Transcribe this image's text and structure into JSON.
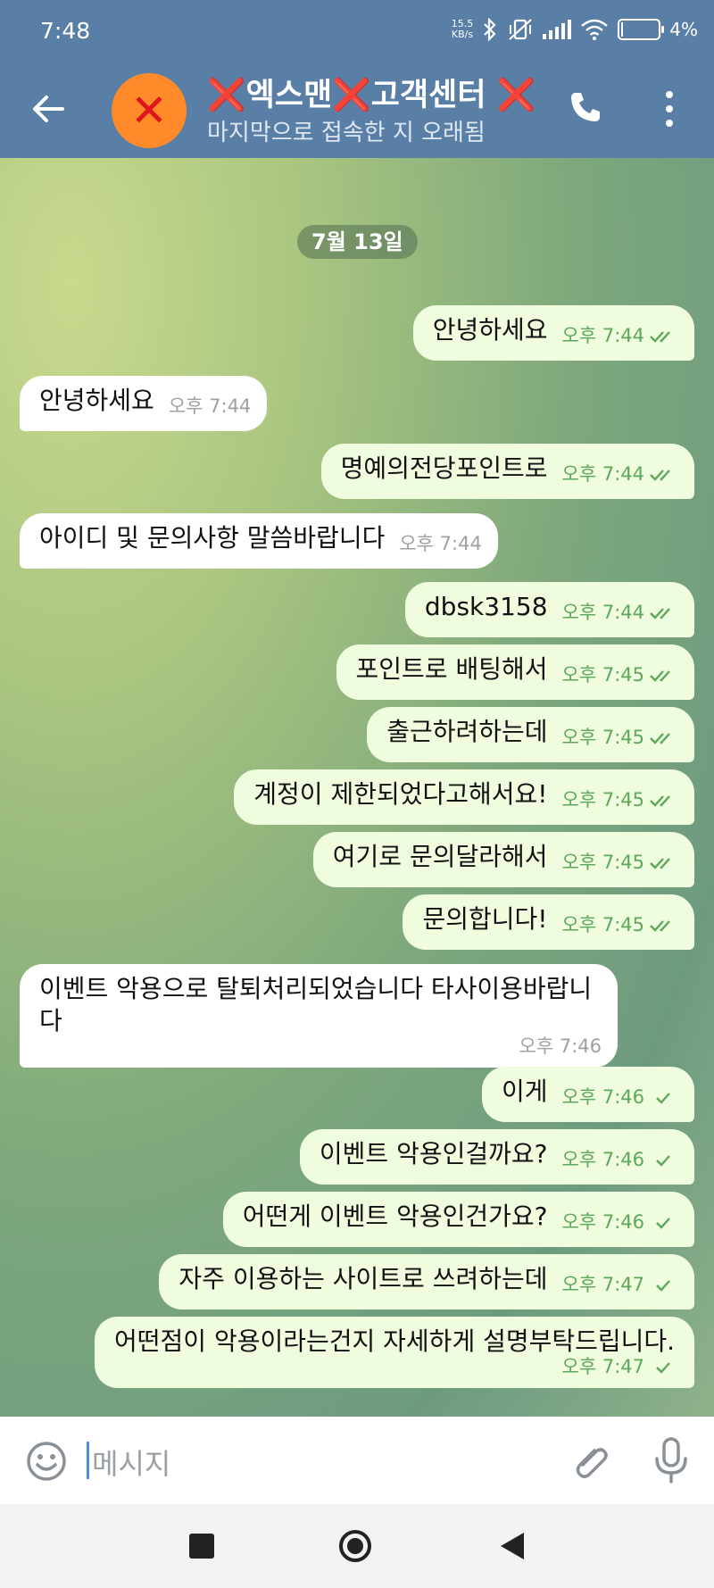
{
  "status_bar": {
    "time": "7:48",
    "net_speed_value": "15.5",
    "net_speed_unit": "KB/s",
    "battery": "4%"
  },
  "header": {
    "title": "❌엑스맨❌고객센터 ❌",
    "subtitle": "마지막으로 접속한 지 오래됨",
    "avatar_icon": "close-x-icon"
  },
  "chat": {
    "date": "7월 13일",
    "messages": [
      {
        "dir": "out",
        "text": "안녕하세요",
        "time": "오후 7:44",
        "status": "read"
      },
      {
        "dir": "in",
        "text": "안녕하세요",
        "time": "오후 7:44"
      },
      {
        "dir": "out",
        "text": "명예의전당포인트로",
        "time": "오후 7:44",
        "status": "read"
      },
      {
        "dir": "in",
        "text": "아이디 및 문의사항 말씀바랍니다",
        "time": "오후 7:44"
      },
      {
        "dir": "out",
        "text": "dbsk3158",
        "time": "오후 7:44",
        "status": "read"
      },
      {
        "dir": "out",
        "text": "포인트로 배팅해서",
        "time": "오후 7:45",
        "status": "read"
      },
      {
        "dir": "out",
        "text": "출근하려하는데",
        "time": "오후 7:45",
        "status": "read"
      },
      {
        "dir": "out",
        "text": "계정이 제한되었다고해서요!",
        "time": "오후 7:45",
        "status": "read"
      },
      {
        "dir": "out",
        "text": "여기로 문의달라해서",
        "time": "오후 7:45",
        "status": "read"
      },
      {
        "dir": "out",
        "text": "문의합니다!",
        "time": "오후 7:45",
        "status": "read"
      },
      {
        "dir": "in",
        "text": "이벤트 악용으로 탈퇴처리되었습니다 타사이용바랍니다",
        "time": "오후 7:46"
      },
      {
        "dir": "out",
        "text": "이게",
        "time": "오후 7:46",
        "status": "sent"
      },
      {
        "dir": "out",
        "text": "이벤트 악용인걸까요?",
        "time": "오후 7:46",
        "status": "sent"
      },
      {
        "dir": "out",
        "text": "어떤게 이벤트 악용인건가요?",
        "time": "오후 7:46",
        "status": "sent"
      },
      {
        "dir": "out",
        "text": "자주 이용하는 사이트로 쓰려하는데",
        "time": "오후 7:47",
        "status": "sent"
      },
      {
        "dir": "out",
        "text": "어떤점이 악용이라는건지 자세하게 설명부탁드립니다.",
        "time": "오후 7:47",
        "status": "sent"
      }
    ]
  },
  "input": {
    "placeholder": "메시지"
  },
  "colors": {
    "header_bg": "#5a7fa6",
    "outgoing_bubble": "#effdde",
    "incoming_bubble": "#ffffff",
    "read_check": "#5ca75a",
    "avatar_bg": "#ff8a2a"
  }
}
